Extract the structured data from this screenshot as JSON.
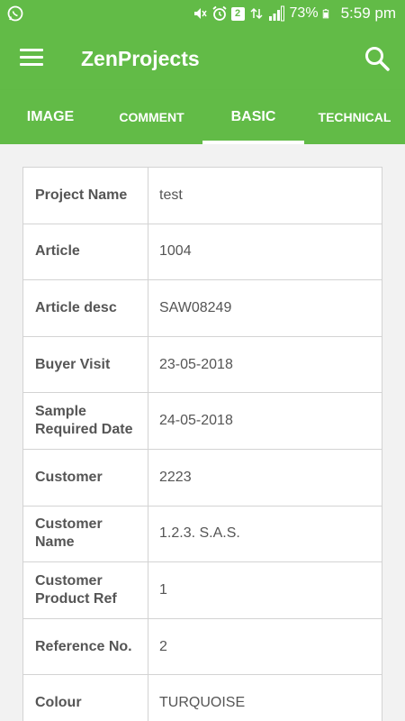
{
  "status_bar": {
    "battery_percent": "73%",
    "time": "5:59 pm",
    "sim_badge": "2",
    "icons": [
      "whatsapp-icon",
      "mute-icon",
      "alarm-icon",
      "sim-2-icon",
      "data-icon",
      "signal-icon",
      "battery-icon"
    ]
  },
  "app_bar": {
    "title": "ZenProjects",
    "color": "#62bb47"
  },
  "tabs": [
    {
      "label": "IMAGE",
      "active": false
    },
    {
      "label": "COMMENT",
      "active": false
    },
    {
      "label": "BASIC",
      "active": true
    },
    {
      "label": "TECHNICAL",
      "active": false
    }
  ],
  "details": [
    {
      "label": "Project Name",
      "value": "test"
    },
    {
      "label": "Article",
      "value": "1004"
    },
    {
      "label": "Article desc",
      "value": "SAW08249"
    },
    {
      "label": "Buyer Visit",
      "value": "23-05-2018"
    },
    {
      "label": "Sample Required Date",
      "value": "24-05-2018"
    },
    {
      "label": "Customer",
      "value": "2223"
    },
    {
      "label": "Customer Name",
      "value": "1.2.3. S.A.S."
    },
    {
      "label": "Customer Product Ref",
      "value": "1"
    },
    {
      "label": "Reference No.",
      "value": "2"
    },
    {
      "label": "Colour",
      "value": "TURQUOISE"
    }
  ]
}
